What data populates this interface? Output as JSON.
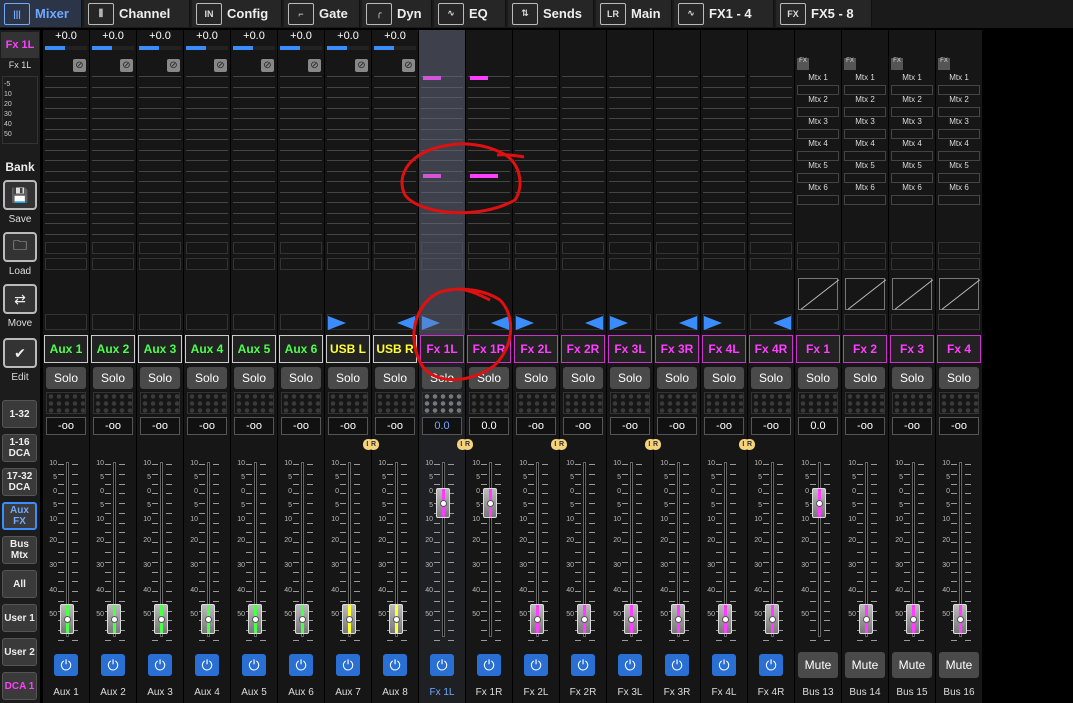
{
  "tabs": [
    {
      "label": "Mixer",
      "icon": "faders-icon",
      "glyph": "|||",
      "active": true
    },
    {
      "label": "Channel",
      "icon": "channel-icon",
      "glyph": "⫼",
      "active": false
    },
    {
      "label": "Config",
      "icon": "input-icon",
      "glyph": "IN",
      "active": false
    },
    {
      "label": "Gate",
      "icon": "gate-icon",
      "glyph": "⌐",
      "active": false
    },
    {
      "label": "Dyn",
      "icon": "dynamics-icon",
      "glyph": "╭",
      "active": false
    },
    {
      "label": "EQ",
      "icon": "eq-icon",
      "glyph": "∿",
      "active": false
    },
    {
      "label": "Sends",
      "icon": "sends-icon",
      "glyph": "⇅",
      "active": false
    },
    {
      "label": "Main",
      "icon": "main-lr-icon",
      "glyph": "LR",
      "active": false
    },
    {
      "label": "FX1 - 4",
      "icon": "fx-wave-icon",
      "glyph": "∿",
      "active": false
    },
    {
      "label": "FX5 - 8",
      "icon": "fx-icon",
      "glyph": "FX",
      "active": false
    }
  ],
  "sidebar": {
    "selected_channel": "Fx 1L",
    "selected_channel_sub": "Fx 1L",
    "meter_scale": [
      "-5",
      "10",
      "20",
      "30",
      "40",
      "50"
    ],
    "bank_label": "Bank",
    "actions": [
      {
        "label": "Save",
        "glyph": "💾"
      },
      {
        "label": "Load",
        "glyph": "🗀"
      },
      {
        "label": "Move",
        "glyph": "⇄"
      },
      {
        "label": "Edit",
        "glyph": "✔"
      }
    ],
    "banks": [
      "1-32",
      "1-16\nDCA",
      "17-32\nDCA",
      "Aux\nFX",
      "Bus\nMtx",
      "All",
      "User 1",
      "User 2",
      "DCA 1"
    ],
    "selected_bank": "Aux\nFX"
  },
  "channels": [
    {
      "name": "Aux 1",
      "bottom": "Aux 1",
      "gain": "+0.0",
      "level": "-oo",
      "color": "#4dff4d",
      "fader": 0.12
    },
    {
      "name": "Aux 2",
      "bottom": "Aux 2",
      "gain": "+0.0",
      "level": "-oo",
      "color": "#4dff4d",
      "fader": 0.12
    },
    {
      "name": "Aux 3",
      "bottom": "Aux 3",
      "gain": "+0.0",
      "level": "-oo",
      "color": "#4dff4d",
      "fader": 0.12
    },
    {
      "name": "Aux 4",
      "bottom": "Aux 4",
      "gain": "+0.0",
      "level": "-oo",
      "color": "#4dff4d",
      "fader": 0.12
    },
    {
      "name": "Aux 5",
      "bottom": "Aux 5",
      "gain": "+0.0",
      "level": "-oo",
      "color": "#4dff4d",
      "fader": 0.12
    },
    {
      "name": "Aux 6",
      "bottom": "Aux 6",
      "gain": "+0.0",
      "level": "-oo",
      "color": "#4dff4d",
      "fader": 0.12
    },
    {
      "name": "USB L",
      "bottom": "Aux 7",
      "gain": "+0.0",
      "level": "-oo",
      "color": "#ffff33",
      "fader": 0.12
    },
    {
      "name": "USB R",
      "bottom": "Aux 8",
      "gain": "+0.0",
      "level": "-oo",
      "color": "#ffff33",
      "fader": 0.12
    },
    {
      "name": "Fx 1L",
      "bottom": "Fx 1L",
      "gain": "",
      "level": "0.0",
      "color": "#ff3fff",
      "fader": 0.78
    },
    {
      "name": "Fx 1R",
      "bottom": "Fx 1R",
      "gain": "",
      "level": "0.0",
      "color": "#ff3fff",
      "fader": 0.78
    },
    {
      "name": "Fx 2L",
      "bottom": "Fx 2L",
      "gain": "",
      "level": "-oo",
      "color": "#ff3fff",
      "fader": 0.12
    },
    {
      "name": "Fx 2R",
      "bottom": "Fx 2R",
      "gain": "",
      "level": "-oo",
      "color": "#ff3fff",
      "fader": 0.12
    },
    {
      "name": "Fx 3L",
      "bottom": "Fx 3L",
      "gain": "",
      "level": "-oo",
      "color": "#ff3fff",
      "fader": 0.12
    },
    {
      "name": "Fx 3R",
      "bottom": "Fx 3R",
      "gain": "",
      "level": "-oo",
      "color": "#ff3fff",
      "fader": 0.12
    },
    {
      "name": "Fx 4L",
      "bottom": "Fx 4L",
      "gain": "",
      "level": "-oo",
      "color": "#ff3fff",
      "fader": 0.12
    },
    {
      "name": "Fx 4R",
      "bottom": "Fx 4R",
      "gain": "",
      "level": "-oo",
      "color": "#ff3fff",
      "fader": 0.12
    },
    {
      "name": "Fx 1",
      "bottom": "Bus 13",
      "gain": "",
      "level": "0.0",
      "color": "#ff3fff",
      "fader": 0.78
    },
    {
      "name": "Fx 2",
      "bottom": "Bus 14",
      "gain": "",
      "level": "-oo",
      "color": "#ff3fff",
      "fader": 0.12
    },
    {
      "name": "Fx 3",
      "bottom": "Bus 15",
      "gain": "",
      "level": "-oo",
      "color": "#ff3fff",
      "fader": 0.12
    },
    {
      "name": "Fx 4",
      "bottom": "Bus 16",
      "gain": "",
      "level": "-oo",
      "color": "#ff3fff",
      "fader": 0.12
    }
  ],
  "strip": {
    "solo_label": "Solo",
    "mute_label": "Mute",
    "fx_badge": "FX",
    "power_glyph": "⏻",
    "lr_labels": [
      "L",
      "R"
    ],
    "fader_scale": [
      "10",
      "5",
      "0",
      "5",
      "10",
      "20",
      "30",
      "40",
      "50"
    ],
    "matrix_labels": [
      "Mtx 1",
      "Mtx 2",
      "Mtx 3",
      "Mtx 4",
      "Mtx 5",
      "Mtx 6"
    ]
  },
  "colors": {
    "accent": "#3a8dff",
    "fx": "#ff3fff",
    "aux": "#4dff4d",
    "usb": "#ffff33",
    "annotation": "#e01010"
  }
}
